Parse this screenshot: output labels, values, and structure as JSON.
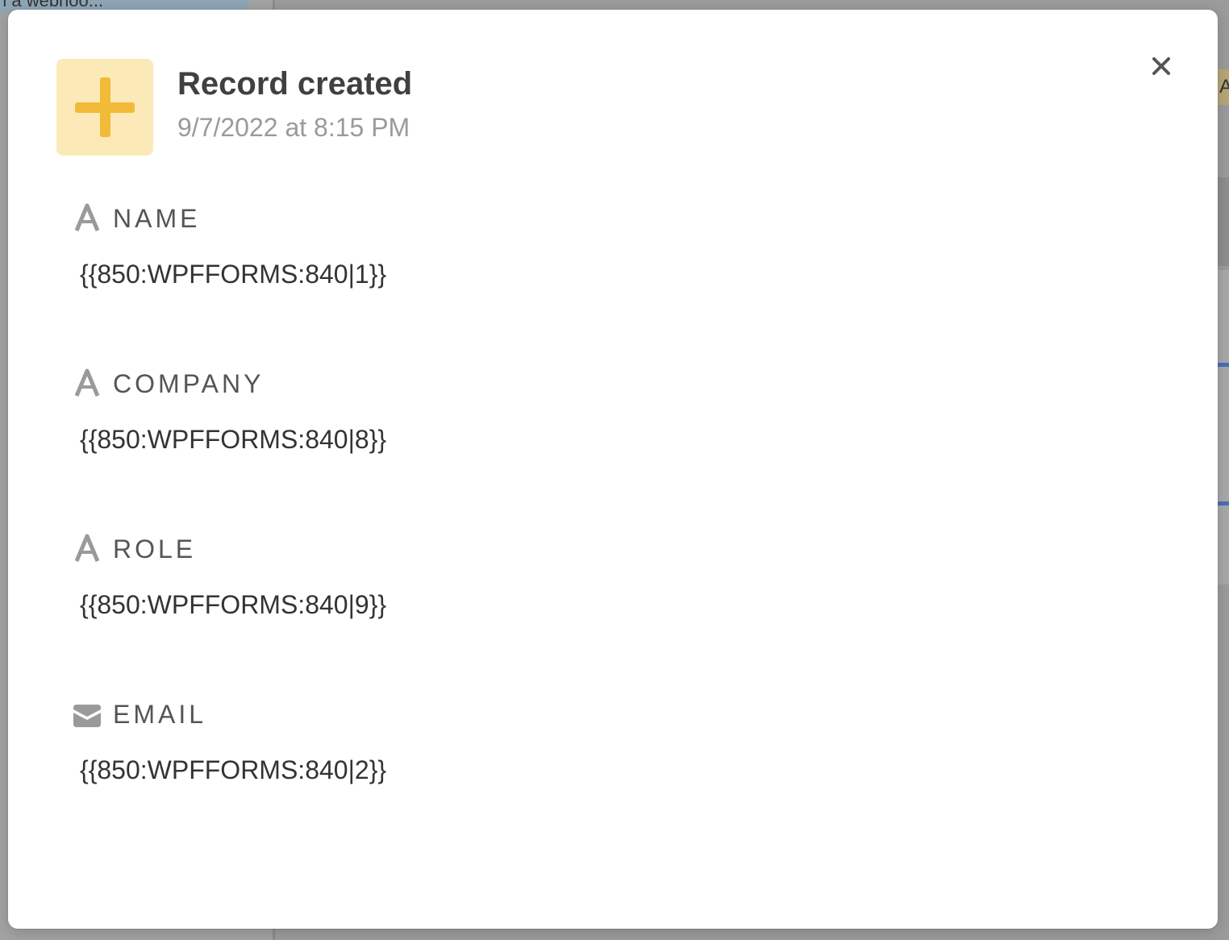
{
  "background": {
    "left_chip_text": "n a webhoo...",
    "right_chip_text": "A"
  },
  "modal": {
    "icon": "plus-icon",
    "title": "Record created",
    "timestamp": "9/7/2022 at 8:15 PM",
    "close_icon": "close-icon",
    "accent_color": "#f1bb38",
    "icon_bg_color": "#fbe9b7",
    "fields": [
      {
        "icon": "text-field-icon",
        "label": "NAME",
        "value": "{{850:WPFFORMS:840|1}}"
      },
      {
        "icon": "text-field-icon",
        "label": "COMPANY",
        "value": "{{850:WPFFORMS:840|8}}"
      },
      {
        "icon": "text-field-icon",
        "label": "ROLE",
        "value": "{{850:WPFFORMS:840|9}}"
      },
      {
        "icon": "email-icon",
        "label": "EMAIL",
        "value": "{{850:WPFFORMS:840|2}}"
      }
    ]
  }
}
